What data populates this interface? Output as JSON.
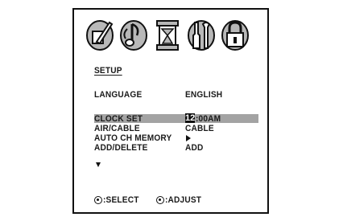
{
  "menu": {
    "icons": [
      {
        "name": "picture-icon"
      },
      {
        "name": "audio-icon"
      },
      {
        "name": "timer-icon"
      },
      {
        "name": "setup-tools-icon"
      },
      {
        "name": "lock-icon"
      }
    ],
    "title": "SETUP",
    "language": {
      "label": "LANGUAGE",
      "value": "ENGLISH"
    },
    "items": [
      {
        "label": "CLOCK SET",
        "value_cursor": "12",
        "value_rest": ":00AM",
        "selected": true
      },
      {
        "label": "AIR/CABLE",
        "value": "CABLE"
      },
      {
        "label": "AUTO CH MEMORY",
        "value_icon": "right-arrow-icon"
      },
      {
        "label": "ADD/DELETE",
        "value": "ADD"
      }
    ],
    "more_indicator": "down-arrow-icon"
  },
  "footer": {
    "select_label": ":SELECT",
    "adjust_label": ":ADJUST"
  },
  "colors": {
    "highlight": "#a3a3a3",
    "text": "#1a1a1a",
    "icon_fill": "#b8b8b8",
    "icon_stroke": "#111111"
  }
}
